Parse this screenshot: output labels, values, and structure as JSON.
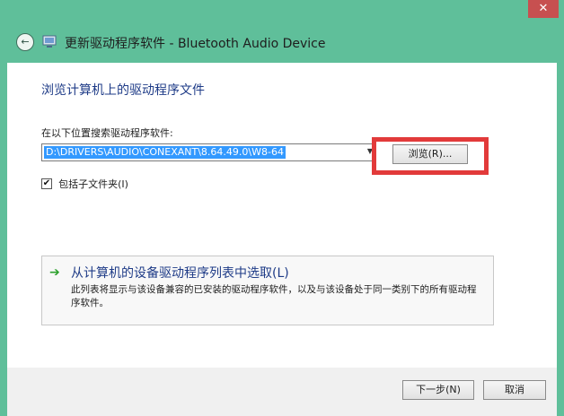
{
  "titlebar": {
    "close_label": "✕"
  },
  "header": {
    "back_label": "←",
    "title": "更新驱动程序软件 - Bluetooth Audio Device"
  },
  "content": {
    "section_title": "浏览计算机上的驱动程序文件",
    "path_label": "在以下位置搜索驱动程序软件:",
    "path_value": "D:\\DRIVERS\\AUDIO\\CONEXANT\\8.64.49.0\\W8-64",
    "browse_label": "浏览(R)...",
    "checkbox_checked": "✔",
    "checkbox_label": "包括子文件夹(I)",
    "pick_title": "从计算机的设备驱动程序列表中选取(L)",
    "pick_desc": "此列表将显示与该设备兼容的已安装的驱动程序软件，以及与该设备处于同一类别下的所有驱动程序软件。"
  },
  "footer": {
    "next_label": "下一步(N)",
    "cancel_label": "取消"
  },
  "colors": {
    "frame": "#5fbf9a",
    "title_blue": "#1e3b87",
    "highlight_red": "#e23a3a",
    "selection_blue": "#3399ff"
  }
}
